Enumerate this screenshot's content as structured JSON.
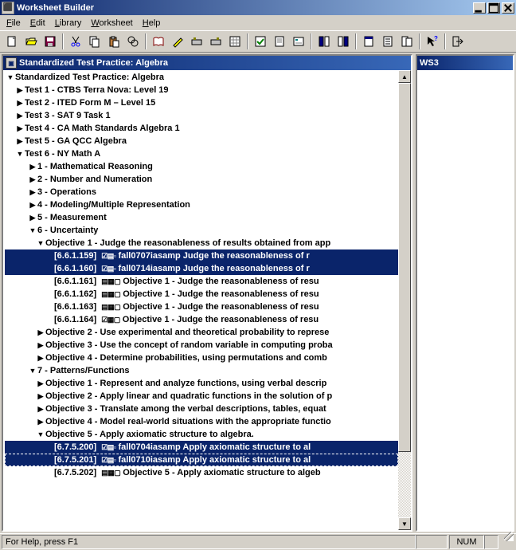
{
  "window": {
    "title": "Worksheet Builder"
  },
  "menu": {
    "file": "File",
    "edit": "Edit",
    "library": "Library",
    "worksheet": "Worksheet",
    "help": "Help"
  },
  "toolbar_icons": [
    "new",
    "open",
    "save",
    "cut",
    "copy",
    "paste",
    "find",
    "book",
    "highlight",
    "tool-a",
    "tool-b",
    "grid",
    "check",
    "sheet",
    "form",
    "col-l",
    "col-r",
    "page-a",
    "page-b",
    "page-c",
    "help-arrow",
    "exit"
  ],
  "left_panel": {
    "title": "Standardized Test Practice: Algebra"
  },
  "right_panel": {
    "title": "WS3"
  },
  "statusbar": {
    "help_text": "For Help, press F1",
    "num": "NUM"
  },
  "tree": [
    {
      "indent": 0,
      "arrow": "open",
      "label": "Standardized Test Practice: Algebra"
    },
    {
      "indent": 1,
      "arrow": "closed",
      "label": "Test 1 - CTBS Terra Nova: Level 19"
    },
    {
      "indent": 1,
      "arrow": "closed",
      "label": "Test 2 - ITED Form M – Level 15"
    },
    {
      "indent": 1,
      "arrow": "closed",
      "label": "Test 3 - SAT 9 Task 1"
    },
    {
      "indent": 1,
      "arrow": "closed",
      "label": "Test 4 - CA Math Standards Algebra 1"
    },
    {
      "indent": 1,
      "arrow": "closed",
      "label": "Test 5 - GA QCC Algebra"
    },
    {
      "indent": 1,
      "arrow": "open",
      "label": "Test 6 - NY Math A"
    },
    {
      "indent": 2,
      "arrow": "closed",
      "label": "1 - Mathematical Reasoning"
    },
    {
      "indent": 2,
      "arrow": "closed",
      "label": "2 - Number and Numeration"
    },
    {
      "indent": 2,
      "arrow": "closed",
      "label": "3 - Operations"
    },
    {
      "indent": 2,
      "arrow": "closed",
      "label": "4 - Modeling/Multiple Representation"
    },
    {
      "indent": 2,
      "arrow": "closed",
      "label": "5 - Measurement"
    },
    {
      "indent": 2,
      "arrow": "open",
      "label": "6 - Uncertainty"
    },
    {
      "indent": 3,
      "arrow": "open",
      "label": "Objective 1 - Judge the reasonableness of results obtained from app"
    },
    {
      "indent": 4,
      "arrow": "none",
      "code": "[6.6.1.159]",
      "mini": "☑▤▫",
      "label": "fall0707iasamp Judge the reasonableness of r",
      "sel": "sel"
    },
    {
      "indent": 4,
      "arrow": "none",
      "code": "[6.6.1.160]",
      "mini": "☑▤▫",
      "label": "fall0714iasamp Judge the reasonableness of r",
      "sel": "sel"
    },
    {
      "indent": 4,
      "arrow": "none",
      "code": "[6.6.1.161]",
      "mini": "▤▦▢",
      "label": "Objective 1 - Judge the reasonableness of resu"
    },
    {
      "indent": 4,
      "arrow": "none",
      "code": "[6.6.1.162]",
      "mini": "▤▦▢",
      "label": "Objective 1 - Judge the reasonableness of resu"
    },
    {
      "indent": 4,
      "arrow": "none",
      "code": "[6.6.1.163]",
      "mini": "▤▦▢",
      "label": "Objective 1 - Judge the reasonableness of resu"
    },
    {
      "indent": 4,
      "arrow": "none",
      "code": "[6.6.1.164]",
      "mini": "☑▦▢",
      "label": "Objective 1 - Judge the reasonableness of resu"
    },
    {
      "indent": 3,
      "arrow": "closed",
      "label": "Objective 2 - Use experimental and theoretical probability to represe"
    },
    {
      "indent": 3,
      "arrow": "closed",
      "label": "Objective 3 - Use the concept of random variable in computing proba"
    },
    {
      "indent": 3,
      "arrow": "closed",
      "label": "Objective 4 - Determine probabilities, using permutations and comb"
    },
    {
      "indent": 2,
      "arrow": "open",
      "label": "7 - Patterns/Functions"
    },
    {
      "indent": 3,
      "arrow": "closed",
      "label": "Objective 1 - Represent and analyze functions, using verbal descrip"
    },
    {
      "indent": 3,
      "arrow": "closed",
      "label": "Objective 2 - Apply linear and quadratic functions in the solution of p"
    },
    {
      "indent": 3,
      "arrow": "closed",
      "label": "Objective 3 - Translate among the verbal descriptions, tables, equat"
    },
    {
      "indent": 3,
      "arrow": "closed",
      "label": "Objective 4 - Model real-world situations with the appropriate functio"
    },
    {
      "indent": 3,
      "arrow": "open",
      "label": "Objective 5 - Apply axiomatic structure to algebra."
    },
    {
      "indent": 4,
      "arrow": "none",
      "code": "[6.7.5.200]",
      "mini": "☑▤▫",
      "label": "fall0704iasamp Apply axiomatic structure to al",
      "sel": "sel"
    },
    {
      "indent": 4,
      "arrow": "none",
      "code": "[6.7.5.201]",
      "mini": "☑▤▫",
      "label": "fall0710iasamp Apply axiomatic structure to al",
      "sel": "sel-dashed"
    },
    {
      "indent": 4,
      "arrow": "none",
      "code": "[6.7.5.202]",
      "mini": "▤▦▢",
      "label": "Objective 5 - Apply axiomatic structure to algeb"
    }
  ]
}
